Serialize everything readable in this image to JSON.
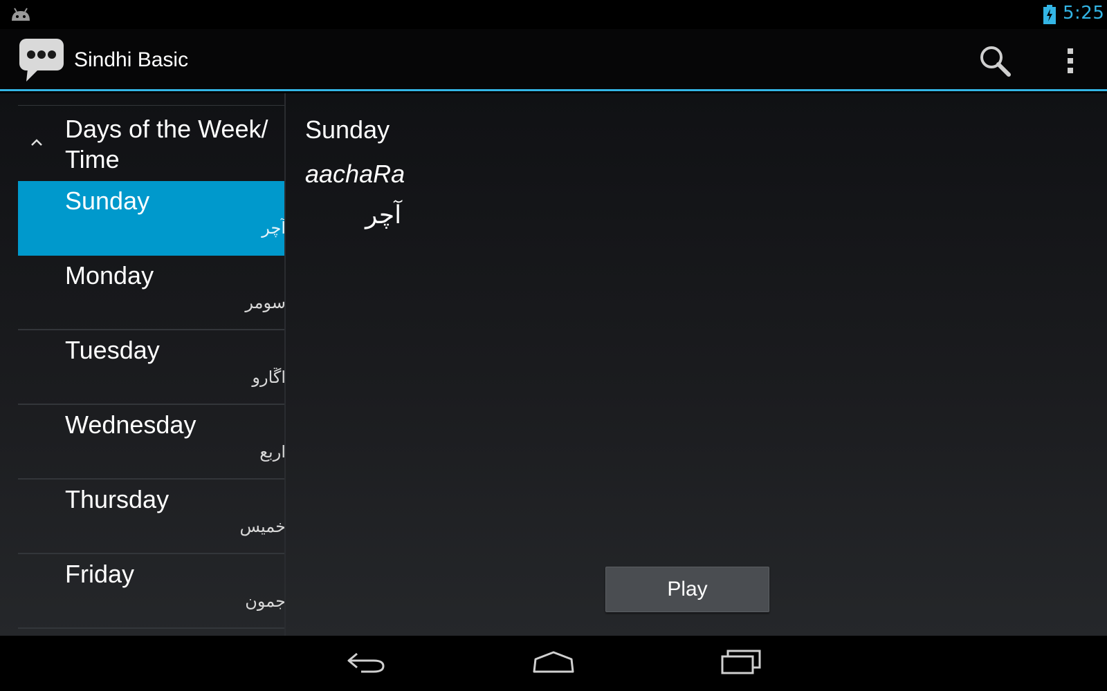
{
  "status_bar": {
    "time": "5:25"
  },
  "action_bar": {
    "title": "Sindhi Basic",
    "icons": {
      "app": "chat-bubble-icon",
      "search": "search-icon",
      "overflow": "overflow-menu-icon"
    }
  },
  "sidebar": {
    "group_title": "Days of the Week/ Time",
    "items": [
      {
        "label": "Sunday",
        "native": "آچر",
        "selected": true
      },
      {
        "label": "Monday",
        "native": "سومر",
        "selected": false
      },
      {
        "label": "Tuesday",
        "native": "اڱارو",
        "selected": false
      },
      {
        "label": "Wednesday",
        "native": "اربع",
        "selected": false
      },
      {
        "label": "Thursday",
        "native": "خميس",
        "selected": false
      },
      {
        "label": "Friday",
        "native": "جمون",
        "selected": false
      }
    ]
  },
  "detail": {
    "word": "Sunday",
    "transliteration": "aachaRa",
    "native": "آچر",
    "play_label": "Play"
  },
  "colors": {
    "accent": "#33b5e5",
    "selected": "#0099cc"
  }
}
